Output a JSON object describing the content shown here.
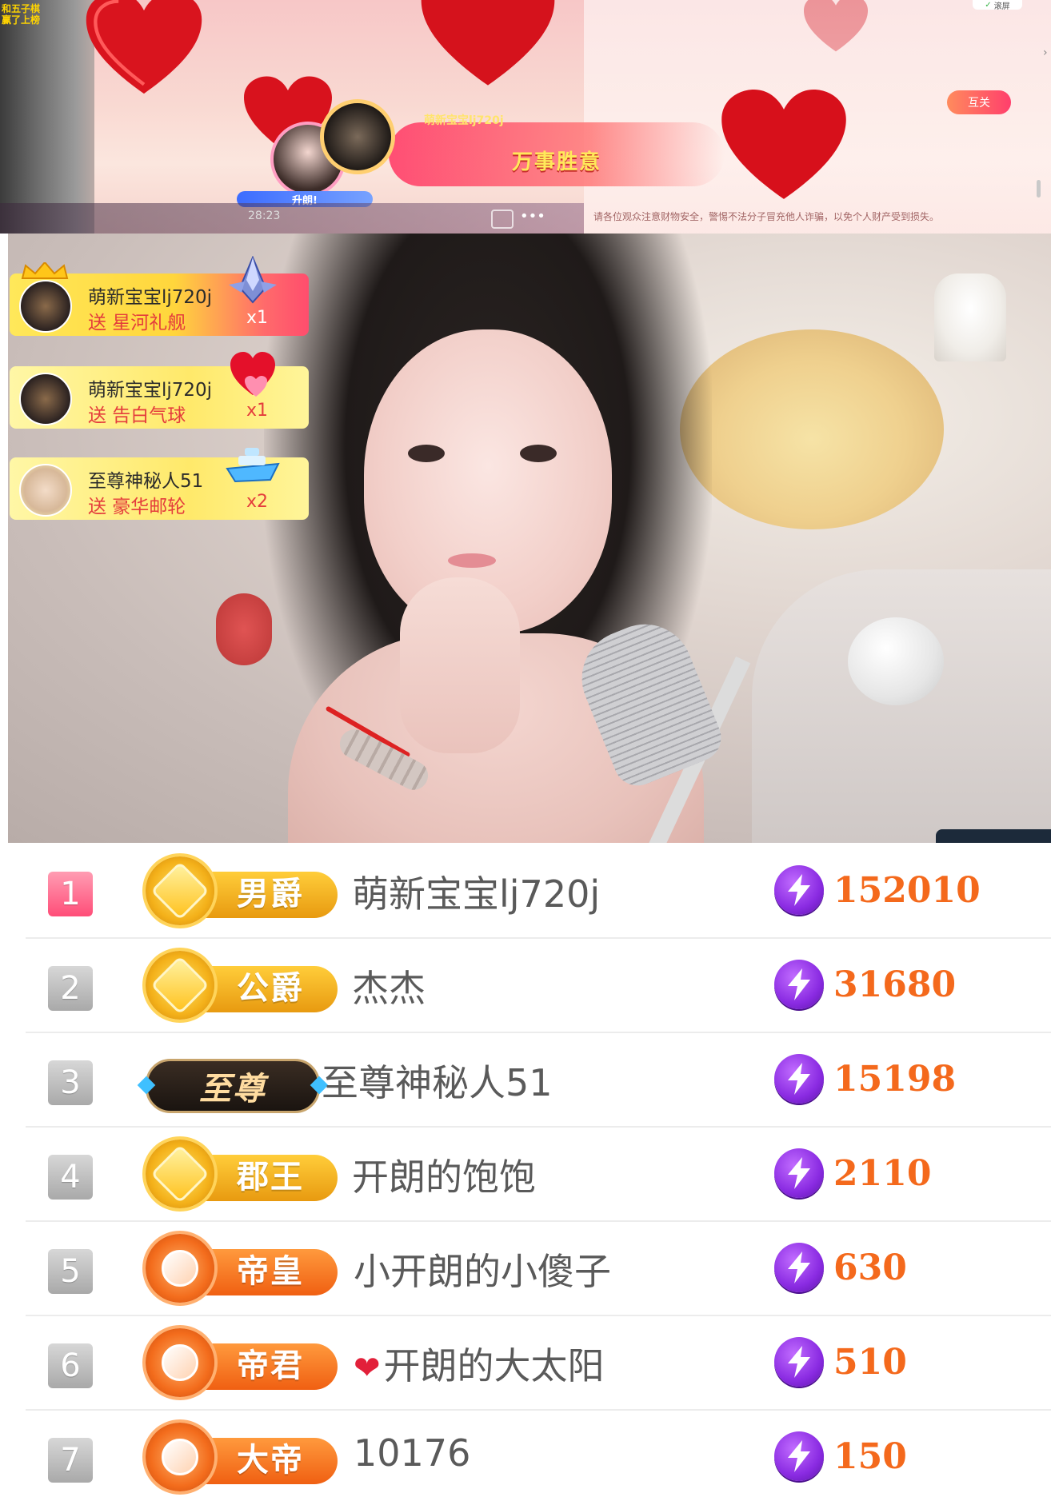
{
  "banner": {
    "corner_note_line1": "和五子棋",
    "corner_note_line2": "赢了上榜",
    "gift_user": "萌新宝宝lj720j",
    "gift_message": "万事胜意",
    "level_text": "升朗!",
    "time": "28:23",
    "follow_button": "互关",
    "scroll_button": "滚屏",
    "warning": "请各位观众注意财物安全，警惕不法分子冒充他人诈骗，以免个人财产受到损失。"
  },
  "gifts": [
    {
      "user": "萌新宝宝lj720j",
      "action": "送 星河礼舰",
      "count": "x1",
      "gift_icon": "starship-gift-icon"
    },
    {
      "user": "萌新宝宝lj720j",
      "action": "送 告白气球",
      "count": "x1",
      "gift_icon": "love-balloon-gift-icon"
    },
    {
      "user": "至尊神秘人51",
      "action": "送 豪华邮轮",
      "count": "x2",
      "gift_icon": "cruise-ship-gift-icon"
    }
  ],
  "leaderboard": [
    {
      "rank": "1",
      "badge": "男爵",
      "badge_style": "gold",
      "name": "萌新宝宝lj720j",
      "score": "152010"
    },
    {
      "rank": "2",
      "badge": "公爵",
      "badge_style": "gold",
      "name": "杰杰",
      "score": "31680"
    },
    {
      "rank": "3",
      "badge": "至尊",
      "badge_style": "zhizun",
      "name": "至尊神秘人51",
      "score": "15198"
    },
    {
      "rank": "4",
      "badge": "郡王",
      "badge_style": "gold",
      "name": "开朗的饱饱",
      "score": "2110"
    },
    {
      "rank": "5",
      "badge": "帝皇",
      "badge_style": "orange",
      "name": "小开朗的小傻子",
      "score": "630"
    },
    {
      "rank": "6",
      "badge": "帝君",
      "badge_style": "orange",
      "name": "开朗的大太阳",
      "name_prefix": "❤",
      "score": "510"
    },
    {
      "rank": "7",
      "badge": "大帝",
      "badge_style": "orange",
      "name": "10176",
      "score": "150"
    }
  ],
  "colors": {
    "score": "#f4691c",
    "rank_first": "#ff4d78",
    "gift_action": "#e43c3c"
  }
}
